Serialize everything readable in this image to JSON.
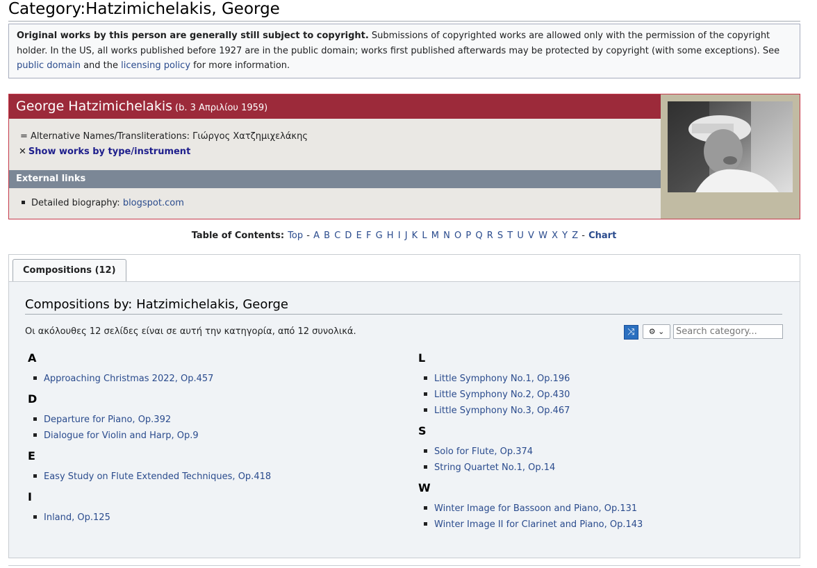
{
  "page": {
    "title": "Category:Hatzimichelakis, George"
  },
  "copyright": {
    "bold_text": "Original works by this person are generally still subject to copyright.",
    "text": " Submissions of copyrighted works are allowed only with the permission of the copyright holder. In the US, all works published before 1927 are in the public domain; works first published afterwards may be protected by copyright (with some exceptions). See ",
    "link_public_domain": "public domain",
    "and_the": " and the ",
    "link_licensing": "licensing policy",
    "for_more": " for more information."
  },
  "person": {
    "name": "George Hatzimichelakis",
    "dates": "(b. 3 Απριλίου 1959)",
    "alt_names": "= Alternative Names/Transliterations: Γιώργος Χατζημιχελάκης",
    "show_works": "Show works by type/instrument",
    "external_links_header": "External links",
    "bio_label": "Detailed biography: ",
    "bio_link": "blogspot.com"
  },
  "toc": {
    "label": "Table of Contents:",
    "top": "Top",
    "letters": [
      "A",
      "B",
      "C",
      "D",
      "E",
      "F",
      "G",
      "H",
      "I",
      "J",
      "K",
      "L",
      "M",
      "N",
      "O",
      "P",
      "Q",
      "R",
      "S",
      "T",
      "U",
      "V",
      "W",
      "X",
      "Y",
      "Z"
    ],
    "chart": "Chart"
  },
  "tabs": {
    "compositions": "Compositions (12)"
  },
  "compositions": {
    "heading": "Compositions by: Hatzimichelakis, George",
    "count_text": "Οι ακόλουθες 12 σελίδες είναι σε αυτή την κατηγορία, από 12 συνολικά.",
    "search_placeholder": "Search category...",
    "left_groups": [
      {
        "letter": "A",
        "items": [
          "Approaching Christmas 2022, Op.457"
        ]
      },
      {
        "letter": "D",
        "items": [
          "Departure for Piano, Op.392",
          "Dialogue for Violin and Harp, Op.9"
        ]
      },
      {
        "letter": "E",
        "items": [
          "Easy Study on Flute Extended Techniques, Op.418"
        ]
      },
      {
        "letter": "I",
        "items": [
          "Inland, Op.125"
        ]
      }
    ],
    "right_groups": [
      {
        "letter": "L",
        "items": [
          "Little Symphony No.1, Op.196",
          "Little Symphony No.2, Op.430",
          "Little Symphony No.3, Op.467"
        ]
      },
      {
        "letter": "S",
        "items": [
          "Solo for Flute, Op.374",
          "String Quartet No.1, Op.14"
        ]
      },
      {
        "letter": "W",
        "items": [
          "Winter Image for Bassoon and Piano, Op.131",
          "Winter Image II for Clarinet and Piano, Op.143"
        ]
      }
    ]
  }
}
